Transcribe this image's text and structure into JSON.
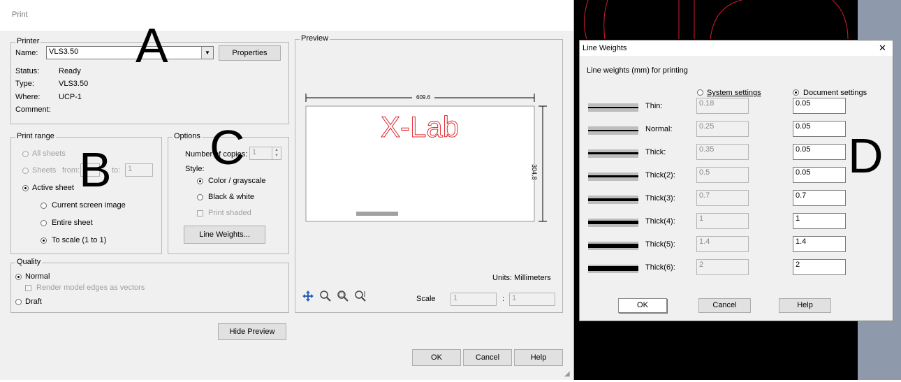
{
  "print_dialog": {
    "title": "Print",
    "printer": {
      "legend": "Printer",
      "name_label": "Name:",
      "name_value": "VLS3.50",
      "properties_label": "Properties",
      "status_label": "Status:",
      "status_value": "Ready",
      "type_label": "Type:",
      "type_value": "VLS3.50",
      "where_label": "Where:",
      "where_value": "UCP-1",
      "comment_label": "Comment:"
    },
    "print_range": {
      "legend": "Print range",
      "all_sheets": "All sheets",
      "sheets": "Sheets",
      "from_label": "from:",
      "to_label": "to:",
      "to_value": "1",
      "active_sheet": "Active sheet",
      "current_screen": "Current screen image",
      "entire_sheet": "Entire sheet",
      "to_scale": "To scale (1 to 1)"
    },
    "options": {
      "legend": "Options",
      "copies_label": "Number of copies:",
      "copies_value": "1",
      "style_label": "Style:",
      "color": "Color / grayscale",
      "bw": "Black & white",
      "print_shaded": "Print shaded",
      "line_weights_btn": "Line Weights..."
    },
    "quality": {
      "legend": "Quality",
      "normal": "Normal",
      "render_edges": "Render model edges as vectors",
      "draft": "Draft"
    },
    "preview": {
      "legend": "Preview",
      "width_dim": "609.6",
      "height_dim": "304.8",
      "logo_text": "X-Lab",
      "units": "Units: Millimeters",
      "scale_label": "Scale",
      "scale_left": "1",
      "scale_sep": ":",
      "scale_right": "1"
    },
    "hide_preview": "Hide Preview",
    "ok": "OK",
    "cancel": "Cancel",
    "help": "Help"
  },
  "line_weights_dialog": {
    "title": "Line Weights",
    "close": "✕",
    "heading": "Line weights (mm) for printing",
    "system_settings": "System settings",
    "document_settings": "Document settings",
    "rows": [
      {
        "label": "Thin:",
        "system": "0.18",
        "document": "0.05"
      },
      {
        "label": "Normal:",
        "system": "0.25",
        "document": "0.05"
      },
      {
        "label": "Thick:",
        "system": "0.35",
        "document": "0.05"
      },
      {
        "label": "Thick(2):",
        "system": "0.5",
        "document": "0.05"
      },
      {
        "label": "Thick(3):",
        "system": "0.7",
        "document": "0.7"
      },
      {
        "label": "Thick(4):",
        "system": "1",
        "document": "1"
      },
      {
        "label": "Thick(5):",
        "system": "1.4",
        "document": "1.4"
      },
      {
        "label": "Thick(6):",
        "system": "2",
        "document": "2"
      }
    ],
    "ok": "OK",
    "cancel": "Cancel",
    "help": "Help"
  },
  "annotations": {
    "a": "A",
    "b": "B",
    "c": "C",
    "d": "D"
  },
  "colors": {
    "logo": "#e0282f",
    "canvas_bg": "#000000",
    "canvas_lines": "#d0202a"
  }
}
